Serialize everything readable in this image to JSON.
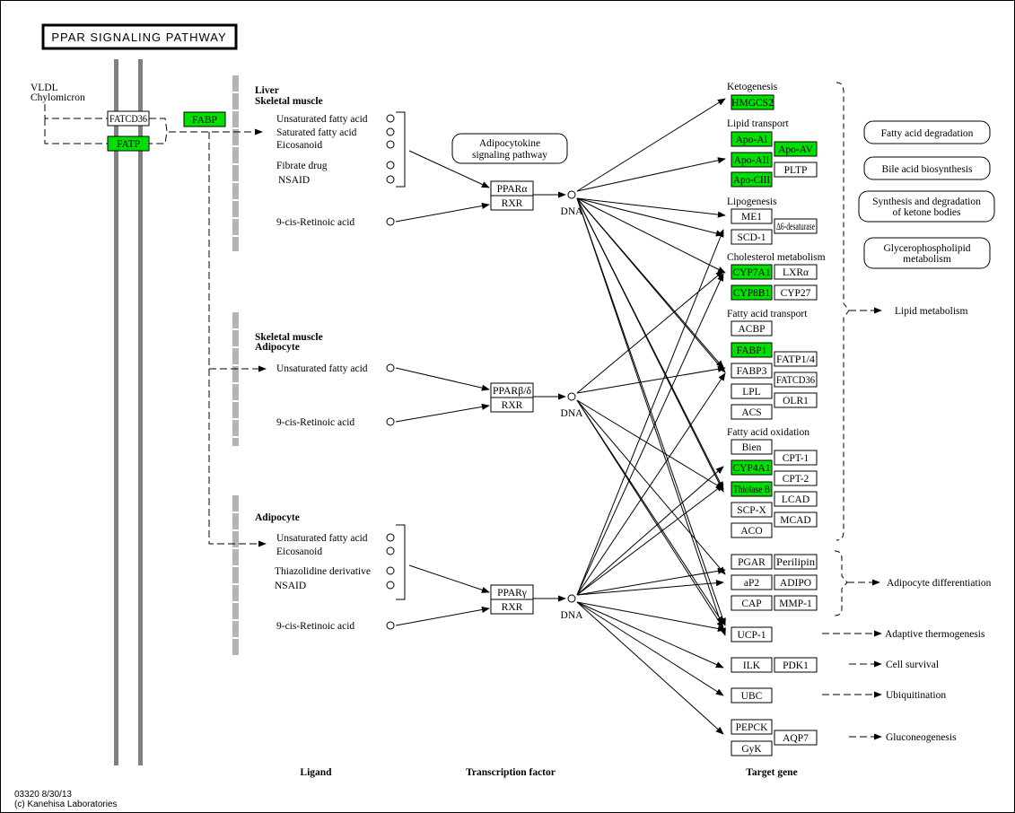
{
  "title": "PPAR SIGNALING PATHWAY",
  "colors": {
    "highlight": "#00e000",
    "plain": "#ffffff",
    "membrane": "#808080",
    "membrane_light": "#b4b4b4"
  },
  "footer": {
    "line1": "03320 8/30/13",
    "line2": "(c) Kanehisa Laboratories"
  },
  "column_labels": {
    "ligand": "Ligand",
    "tf": "Transcription factor",
    "target": "Target gene"
  },
  "source": {
    "line1": "VLDL",
    "line2": "Chylomicron"
  },
  "membrane_genes": [
    {
      "id": "fatcd36",
      "label": "FATCD36",
      "highlighted": false
    },
    {
      "id": "fatp",
      "label": "FATP",
      "highlighted": true
    },
    {
      "id": "fabp",
      "label": "FABP",
      "highlighted": true
    }
  ],
  "tissues": [
    {
      "id": "liver",
      "line1": "Liver",
      "line2": "Skeletal muscle"
    },
    {
      "id": "skm",
      "line1": "Skeletal muscle",
      "line2": "Adipocyte"
    },
    {
      "id": "adipo",
      "line1": "Adipocyte",
      "line2": ""
    }
  ],
  "ligands": {
    "alpha": [
      "Unsaturated fatty acid",
      "Saturated fatty acid",
      "Eicosanoid",
      "Fibrate drug",
      "NSAID",
      "9-cis-Retinoic acid"
    ],
    "delta": [
      "Unsaturated fatty acid",
      "9-cis-Retinoic acid"
    ],
    "gamma": [
      "Unsaturated fatty acid",
      "Eicosanoid",
      "Thiazolidine derivative",
      "NSAID",
      "9-cis-Retinoic acid"
    ]
  },
  "transcription_factors": [
    {
      "id": "alpha",
      "top": "PPARα",
      "bottom": "RXR",
      "dna": "DNA"
    },
    {
      "id": "delta",
      "top": "PPARβ/δ",
      "bottom": "RXR",
      "dna": "DNA"
    },
    {
      "id": "gamma",
      "top": "PPARγ",
      "bottom": "RXR",
      "dna": "DNA"
    }
  ],
  "adipocytokine_map": {
    "line1": "Adipocytokine",
    "line2": "signaling pathway"
  },
  "target_groups": [
    {
      "label": "Ketogenesis"
    },
    {
      "label": "Lipid transport"
    },
    {
      "label": "Lipogenesis"
    },
    {
      "label": "Cholesterol metabolism"
    },
    {
      "label": "Fatty acid transport"
    },
    {
      "label": "Fatty acid oxidation"
    }
  ],
  "target_genes": [
    {
      "label": "HMGCS2",
      "highlighted": true
    },
    {
      "label": "Apo-AI",
      "highlighted": true
    },
    {
      "label": "Apo-AII",
      "highlighted": true
    },
    {
      "label": "Apo-CIII",
      "highlighted": true
    },
    {
      "label": "Apo-AV",
      "highlighted": true
    },
    {
      "label": "PLTP",
      "highlighted": false
    },
    {
      "label": "ME1",
      "highlighted": false
    },
    {
      "label": "SCD-1",
      "highlighted": false
    },
    {
      "label": "Δ6-desaturase",
      "highlighted": false
    },
    {
      "label": "CYP7A1",
      "highlighted": true
    },
    {
      "label": "CYP8B1",
      "highlighted": true
    },
    {
      "label": "LXRα",
      "highlighted": false
    },
    {
      "label": "CYP27",
      "highlighted": false
    },
    {
      "label": "ACBP",
      "highlighted": false
    },
    {
      "label": "FABP1",
      "highlighted": true
    },
    {
      "label": "FABP3",
      "highlighted": false
    },
    {
      "label": "LPL",
      "highlighted": false
    },
    {
      "label": "ACS",
      "highlighted": false
    },
    {
      "label": "FATP1/4",
      "highlighted": false
    },
    {
      "label": "FATCD36",
      "highlighted": false
    },
    {
      "label": "OLR1",
      "highlighted": false
    },
    {
      "label": "Bien",
      "highlighted": false
    },
    {
      "label": "CYP4A1",
      "highlighted": true
    },
    {
      "label": "Thiolase B",
      "highlighted": true
    },
    {
      "label": "SCP-X",
      "highlighted": false
    },
    {
      "label": "ACO",
      "highlighted": false
    },
    {
      "label": "CPT-1",
      "highlighted": false
    },
    {
      "label": "CPT-2",
      "highlighted": false
    },
    {
      "label": "LCAD",
      "highlighted": false
    },
    {
      "label": "MCAD",
      "highlighted": false
    },
    {
      "label": "PGAR",
      "highlighted": false
    },
    {
      "label": "aP2",
      "highlighted": false
    },
    {
      "label": "CAP",
      "highlighted": false
    },
    {
      "label": "Perilipin",
      "highlighted": false
    },
    {
      "label": "ADIPO",
      "highlighted": false
    },
    {
      "label": "MMP-1",
      "highlighted": false
    },
    {
      "label": "UCP-1",
      "highlighted": false
    },
    {
      "label": "ILK",
      "highlighted": false
    },
    {
      "label": "PDK1",
      "highlighted": false
    },
    {
      "label": "UBC",
      "highlighted": false
    },
    {
      "label": "PEPCK",
      "highlighted": false
    },
    {
      "label": "GyK",
      "highlighted": false
    },
    {
      "label": "AQP7",
      "highlighted": false
    }
  ],
  "pathway_maps": [
    {
      "line1": "Fatty acid degradation",
      "line2": ""
    },
    {
      "line1": "Bile acid biosynthesis",
      "line2": ""
    },
    {
      "line1": "Synthesis and degradation",
      "line2": "of ketone bodies"
    },
    {
      "line1": "Glycerophospholipid",
      "line2": "metabolism"
    }
  ],
  "outcomes": [
    {
      "label": "Lipid metabolism"
    },
    {
      "label": "Adipocyte differentiation"
    },
    {
      "label": "Adaptive thermogenesis"
    },
    {
      "label": "Cell survival"
    },
    {
      "label": "Ubiquitination"
    },
    {
      "label": "Gluconeogenesis"
    }
  ]
}
